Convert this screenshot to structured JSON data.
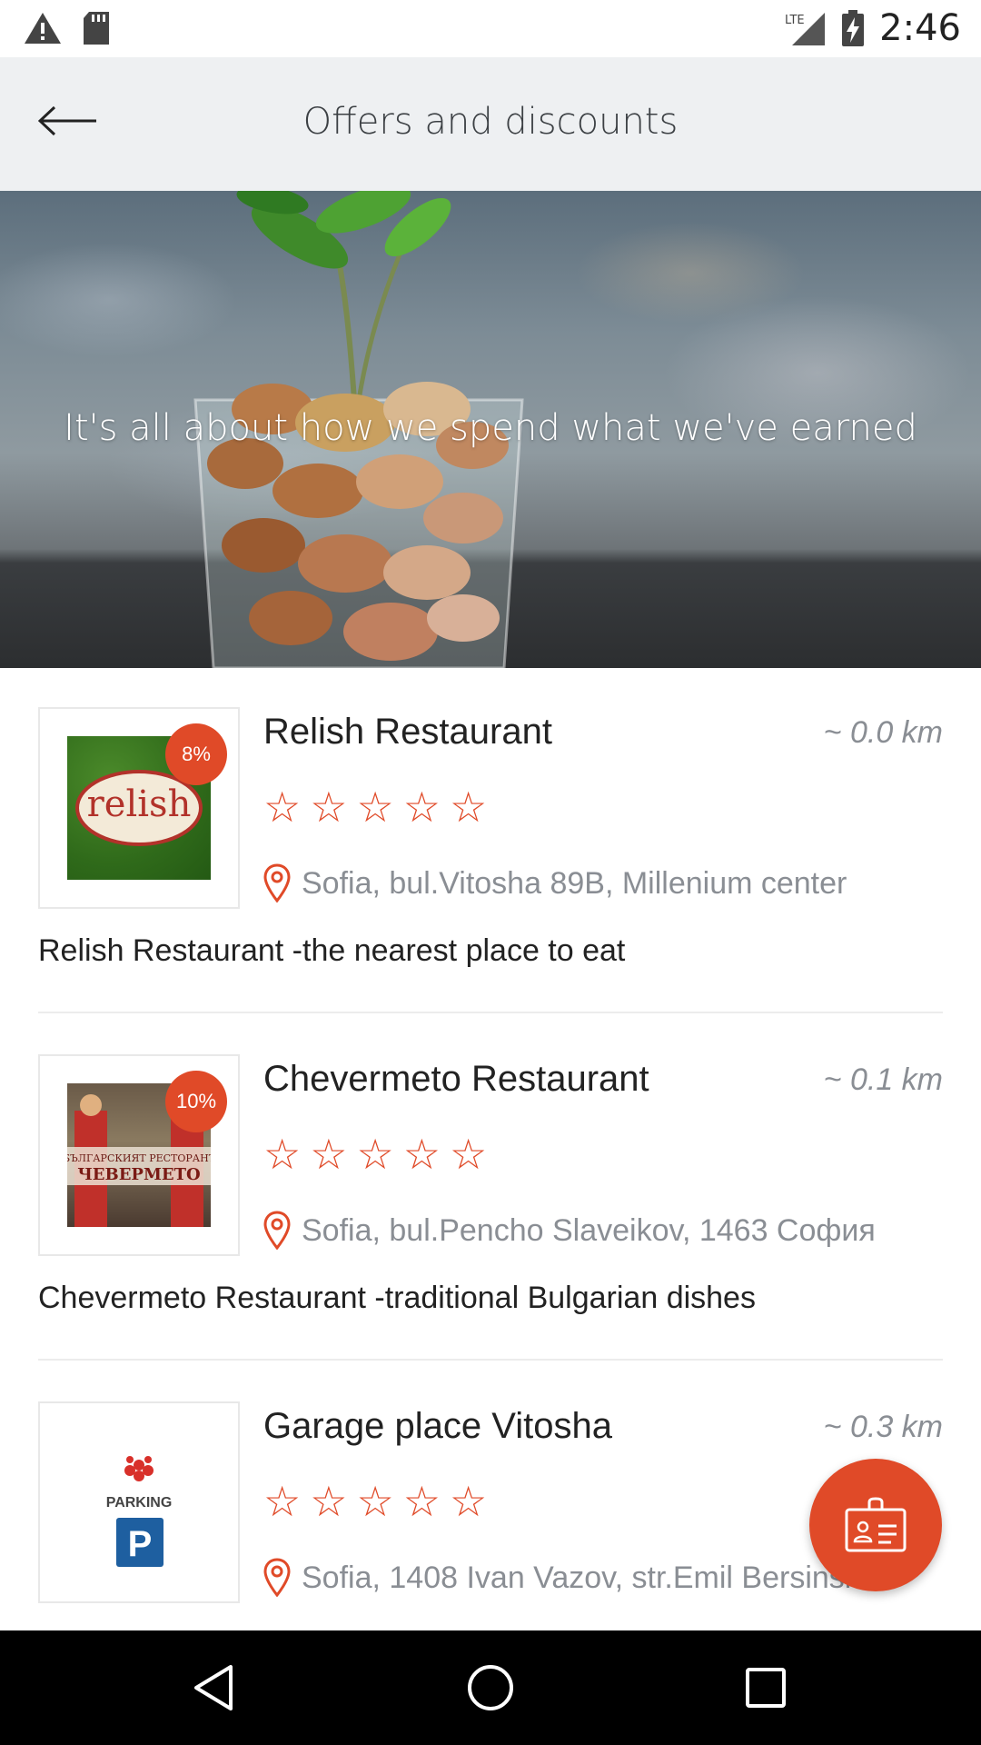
{
  "status_bar": {
    "time": "2:46",
    "network": "LTE",
    "icons": [
      "warning-icon",
      "sd-card-icon",
      "signal-icon",
      "battery-charging-icon"
    ]
  },
  "app_bar": {
    "title": "Offers and discounts",
    "back_icon": "arrow-back-icon"
  },
  "hero": {
    "text": "It's all about how we spend what we've earned"
  },
  "offers": [
    {
      "name": "Relish Restaurant",
      "distance": "~ 0.0 km",
      "discount": "8%",
      "rating_stars": 5,
      "stars_filled": 0,
      "address": "Sofia, bul.Vitosha 89B, Millenium center",
      "description": "Relish Restaurant -the nearest place to eat",
      "logo_text": "relish"
    },
    {
      "name": "Chevermeto Restaurant",
      "distance": "~ 0.1 km",
      "discount": "10%",
      "rating_stars": 5,
      "stars_filled": 0,
      "address": "Sofia, bul.Pencho Slaveikov, 1463 София",
      "description": "Chevermeto Restaurant -traditional Bulgarian dishes",
      "logo_text": "БЪЛГАРСКИЯТ РЕСТОРАНТ ЧЕВЕРМЕТО"
    },
    {
      "name": "Garage place Vitosha",
      "distance": "~ 0.3 km",
      "discount": "",
      "rating_stars": 5,
      "stars_filled": 0,
      "address": "Sofia, 1408 Ivan Vazov, str.Emil Bersinski...",
      "description": "",
      "logo_text": "PARKING",
      "logo_letter": "P"
    }
  ],
  "fab": {
    "icon": "id-card-icon"
  },
  "nav_bar": {
    "buttons": [
      "back-triangle-icon",
      "home-circle-icon",
      "recents-square-icon"
    ]
  },
  "colors": {
    "accent": "#e04a28",
    "app_bar_bg": "#eef0f2",
    "secondary_text": "#8a8e94"
  }
}
